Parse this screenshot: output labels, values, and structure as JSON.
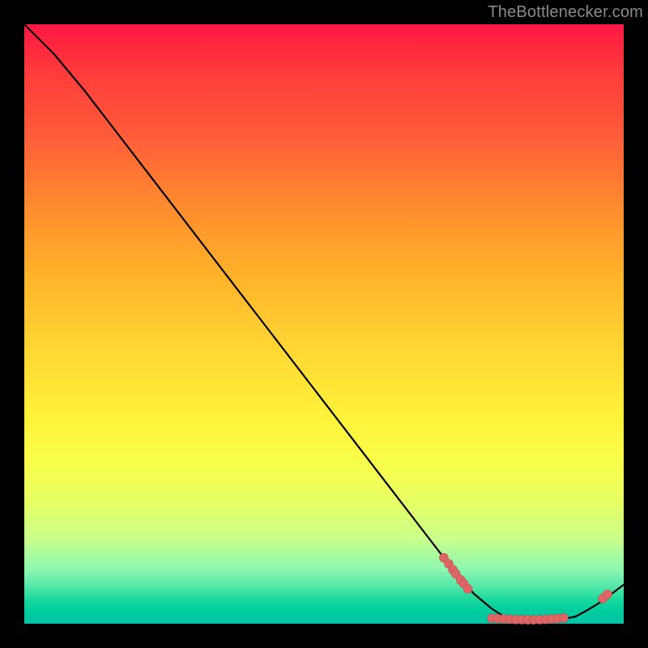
{
  "credit_text": "TheBottlenecker.com",
  "colors": {
    "line": "#000000",
    "marker_fill": "#e06666",
    "marker_stroke": "#c15252",
    "background_black": "#000000"
  },
  "chart_data": {
    "type": "line",
    "title": "",
    "xlabel": "",
    "ylabel": "",
    "xlim": [
      0,
      100
    ],
    "ylim": [
      0,
      100
    ],
    "x": [
      0,
      5,
      10,
      15,
      20,
      25,
      30,
      35,
      40,
      45,
      50,
      55,
      60,
      65,
      70,
      72,
      75,
      78,
      80,
      82,
      84,
      86,
      88,
      90,
      92,
      94,
      96,
      98,
      100
    ],
    "y": [
      100,
      95,
      89,
      82.5,
      76,
      69.5,
      63,
      56.5,
      50,
      43.5,
      37,
      30.5,
      24,
      17.5,
      11,
      8.5,
      5,
      2.5,
      1.2,
      0.7,
      0.5,
      0.5,
      0.6,
      0.8,
      1.2,
      2.3,
      3.5,
      5,
      6.5
    ],
    "marker_clusters": [
      {
        "group": "left",
        "points": [
          {
            "x": 70,
            "y": 11
          },
          {
            "x": 70.8,
            "y": 10
          },
          {
            "x": 71.5,
            "y": 9
          },
          {
            "x": 72,
            "y": 8.3
          },
          {
            "x": 72.8,
            "y": 7.3
          },
          {
            "x": 73.3,
            "y": 6.7
          },
          {
            "x": 74,
            "y": 5.8
          }
        ]
      },
      {
        "group": "bottom_row",
        "points": [
          {
            "x": 78,
            "y": 0.9
          },
          {
            "x": 79,
            "y": 0.85
          },
          {
            "x": 80,
            "y": 0.8
          },
          {
            "x": 81,
            "y": 0.75
          },
          {
            "x": 82,
            "y": 0.7
          },
          {
            "x": 83,
            "y": 0.68
          },
          {
            "x": 84,
            "y": 0.66
          },
          {
            "x": 85,
            "y": 0.65
          },
          {
            "x": 86,
            "y": 0.68
          },
          {
            "x": 87,
            "y": 0.72
          },
          {
            "x": 88,
            "y": 0.78
          },
          {
            "x": 89,
            "y": 0.85
          },
          {
            "x": 90,
            "y": 0.95
          }
        ]
      },
      {
        "group": "right_pair",
        "points": [
          {
            "x": 96.5,
            "y": 4.2
          },
          {
            "x": 97.3,
            "y": 4.9
          }
        ]
      }
    ],
    "marker_radius": 5.5
  }
}
